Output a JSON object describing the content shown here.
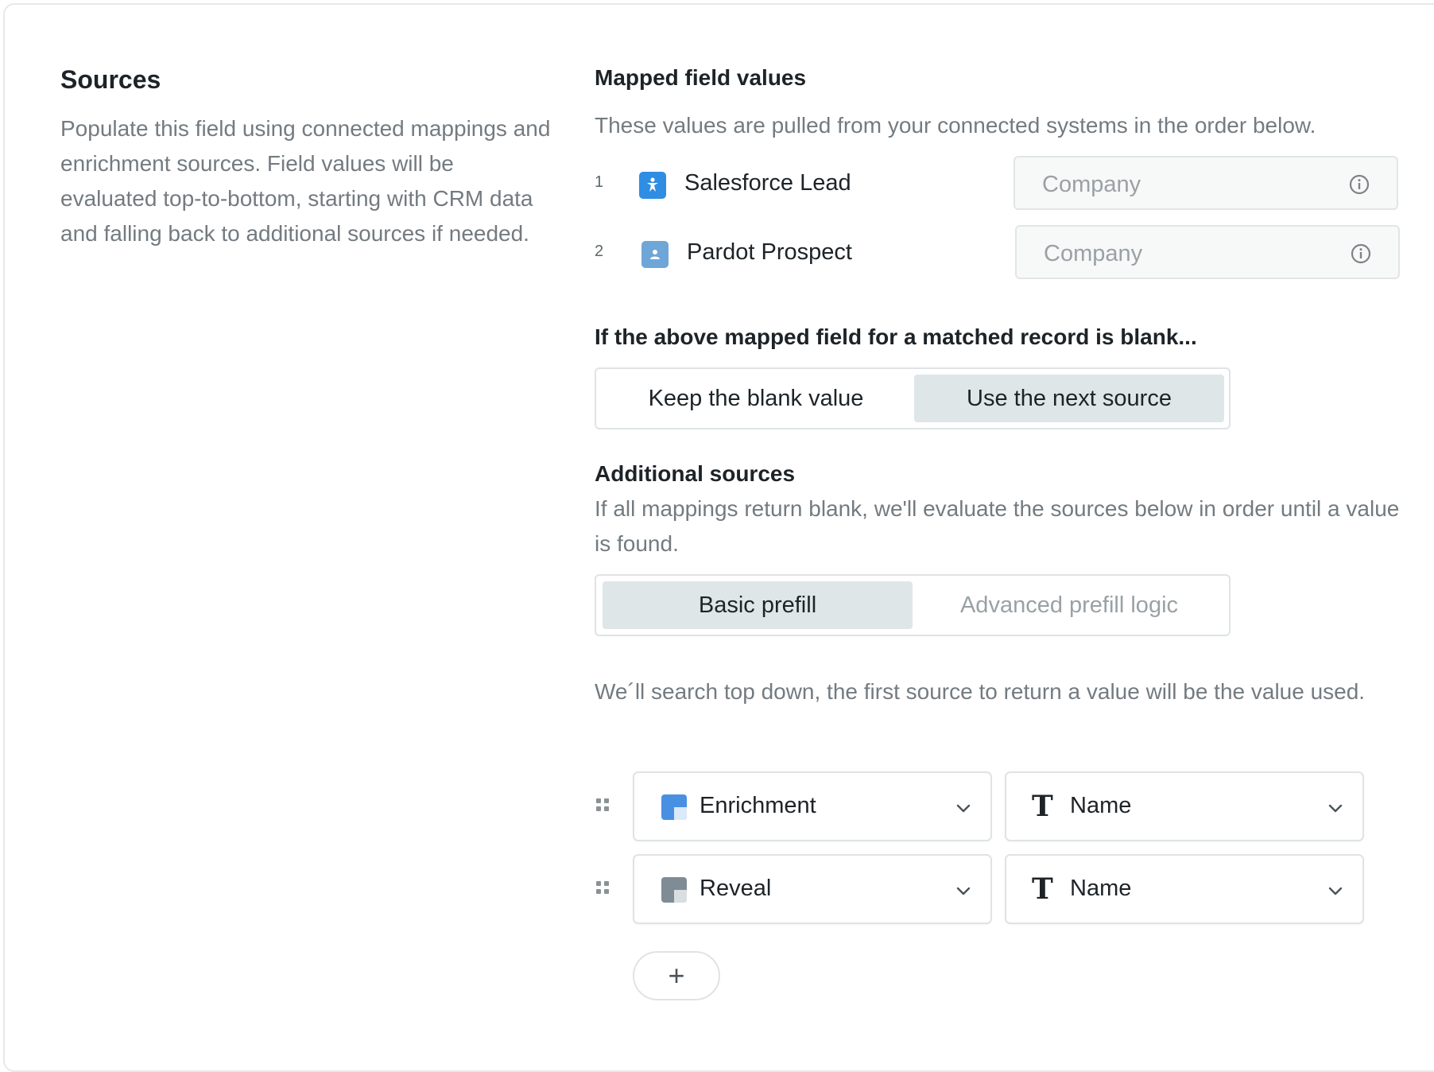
{
  "left": {
    "title": "Sources",
    "description": "Populate this field using connected mappings and enrichment sources. Field values will be evaluated top-to-bottom, starting with CRM data and falling back to additional sources if needed."
  },
  "mapped": {
    "title": "Mapped field values",
    "subtitle": "These values are pulled from your connected systems in the order below.",
    "rows": [
      {
        "num": "1",
        "source": "Salesforce Lead",
        "icon": "salesforce-person-icon",
        "field_placeholder": "Company"
      },
      {
        "num": "2",
        "source": "Pardot Prospect",
        "icon": "pardot-person-icon",
        "field_placeholder": "Company"
      }
    ]
  },
  "blank": {
    "title": "If the above mapped field for a matched record is blank...",
    "options": [
      "Keep the blank value",
      "Use the next source"
    ],
    "selected": "Use the next source"
  },
  "additional": {
    "title": "Additional sources",
    "subtitle": "If all mappings return blank, we'll evaluate the sources below in order until a value is found.",
    "modes": [
      "Basic prefill",
      "Advanced prefill logic"
    ],
    "selected_mode": "Basic prefill",
    "hint": "We´ll search top down, the first source to return a value will be the value used.",
    "sources": [
      {
        "source": "Enrichment",
        "source_icon": "enrichment-icon",
        "field": "Name",
        "field_icon": "text-type-icon"
      },
      {
        "source": "Reveal",
        "source_icon": "reveal-icon",
        "field": "Name",
        "field_icon": "text-type-icon"
      }
    ],
    "add_label": "+"
  },
  "colors": {
    "salesforce_blue": "#2f8de4",
    "pardot_blue": "#6ea6d8",
    "enrichment_blue": "#4a90e2",
    "reveal_gray": "#7f8c96",
    "segment_active": "#dfe6e7"
  }
}
